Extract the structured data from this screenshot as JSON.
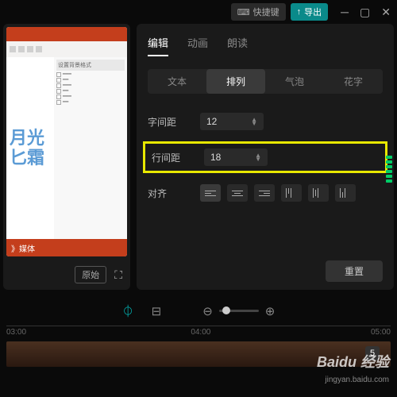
{
  "titlebar": {
    "shortcut": "快捷键",
    "export": "导出"
  },
  "tabs": [
    "编辑",
    "动画",
    "朗读"
  ],
  "subtabs": [
    "文本",
    "排列",
    "气泡",
    "花字"
  ],
  "rows": {
    "charSpacing": {
      "label": "字间距",
      "value": "12"
    },
    "lineSpacing": {
      "label": "行间距",
      "value": "18"
    },
    "align": {
      "label": "对齐"
    }
  },
  "reset": "重置",
  "preview": {
    "original": "原始",
    "slideText1": "月光",
    "slideText2": "匕霜",
    "panelTitle": "设置背景格式",
    "footer": "》媒体"
  },
  "timeline": {
    "marks": [
      "03:00",
      "04:00",
      "05:00"
    ],
    "clip": "5"
  },
  "watermark": {
    "main": "Baidu 经验",
    "sub": "jingyan.baidu.com"
  }
}
